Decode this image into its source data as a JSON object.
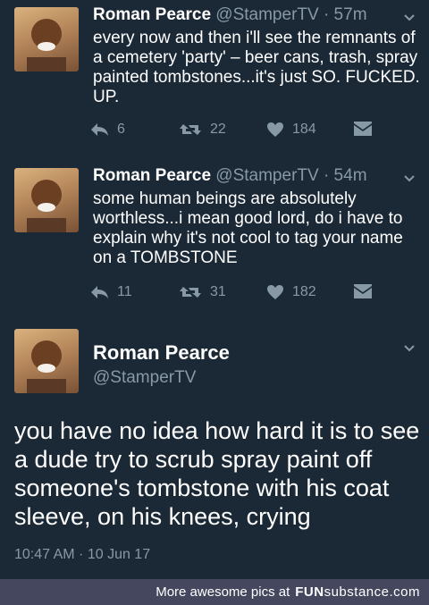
{
  "tweets": [
    {
      "name": "Roman Pearce",
      "handle": "@StamperTV",
      "time": "· 57m",
      "text": "every now and then i'll see the remnants of a cemetery 'party' – beer cans, trash, spray painted tombstones...it's just SO. FUCKED. UP.",
      "replies": "6",
      "retweets": "22",
      "likes": "184"
    },
    {
      "name": "Roman Pearce",
      "handle": "@StamperTV",
      "time": "· 54m",
      "text": "some human beings are absolutely worthless...i mean good lord, do i have to explain why it's not cool to tag your name on a TOMBSTONE",
      "replies": "11",
      "retweets": "31",
      "likes": "182"
    }
  ],
  "main_tweet": {
    "name": "Roman Pearce",
    "handle": "@StamperTV",
    "text": "you have no idea how hard it is to see a dude try to scrub spray paint off someone's tombstone with his coat sleeve, on his knees, crying",
    "timestamp": "10:47 AM · 10 Jun 17"
  },
  "footer": {
    "text": "More awesome pics at",
    "brand_fun": "FUN",
    "brand_sub": "substance",
    "brand_tld": ".com"
  },
  "colors": {
    "background": "#1b2836",
    "muted": "#8899a6",
    "footer_bg": "#45475f"
  }
}
